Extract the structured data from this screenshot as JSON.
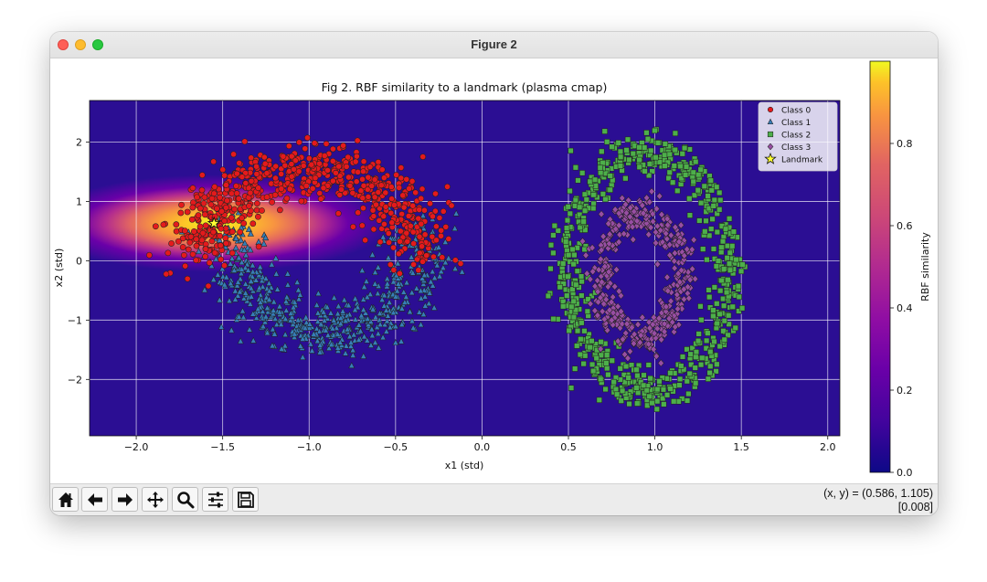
{
  "window": {
    "title": "Figure 2"
  },
  "toolbar": {
    "buttons": [
      "home",
      "back",
      "forward",
      "pan",
      "zoom",
      "configure-subplots",
      "save"
    ],
    "coords_line1": "(x, y) = (0.586, 1.105)",
    "coords_line2": "[0.008]"
  },
  "chart_data": {
    "type": "scatter",
    "title": "Fig 2. RBF similarity to a landmark (plasma cmap)",
    "xlabel": "x1 (std)",
    "ylabel": "x2 (std)",
    "xlim": [
      -2.27,
      2.07
    ],
    "ylim": [
      -2.95,
      2.7
    ],
    "x_ticks": [
      "−2.0",
      "−1.5",
      "−1.0",
      "−0.5",
      "0.0",
      "0.5",
      "1.0",
      "1.5",
      "2.0"
    ],
    "x_tick_values": [
      -2.0,
      -1.5,
      -1.0,
      -0.5,
      0.0,
      0.5,
      1.0,
      1.5,
      2.0
    ],
    "y_ticks": [
      "−2",
      "−1",
      "0",
      "1",
      "2"
    ],
    "y_tick_values": [
      -2,
      -1,
      0,
      1,
      2
    ],
    "grid": true,
    "legend_position": "top-right",
    "background": {
      "colormap": "plasma",
      "kind": "rbf",
      "center": [
        -1.55,
        0.63
      ],
      "gamma": 2.5
    },
    "colorbar": {
      "label": "RBF similarity",
      "range": [
        0.0,
        1.0
      ],
      "tick_labels": [
        "0.0",
        "0.2",
        "0.4",
        "0.6",
        "0.8"
      ],
      "tick_values": [
        0.0,
        0.2,
        0.4,
        0.6,
        0.8
      ]
    },
    "landmark": {
      "name": "Landmark",
      "x": -1.55,
      "y": 0.63,
      "color": "#ffff33"
    },
    "series": [
      {
        "name": "Class 0",
        "marker": "circle",
        "color": "#e41a1c",
        "shape": "upper-moon",
        "center": [
          -1.0,
          0.1
        ],
        "radius": 0.62,
        "noise": 0.12,
        "angle_range": [
          0,
          180
        ],
        "y_scale": 2.3,
        "points": 700
      },
      {
        "name": "Class 1",
        "marker": "triangle",
        "color": "#377eb8",
        "shape": "lower-moon",
        "center": [
          -0.9,
          0.55
        ],
        "radius": 0.55,
        "noise": 0.11,
        "angle_range": [
          180,
          360
        ],
        "y_scale": 3.2,
        "points": 600
      },
      {
        "name": "Class 2",
        "marker": "square",
        "color": "#4daf4a",
        "shape": "ring",
        "center": [
          0.96,
          -0.2
        ],
        "rx": 0.46,
        "ry": 2.0,
        "noise": 0.05,
        "points": 700
      },
      {
        "name": "Class 3",
        "marker": "diamond",
        "color": "#984ea3",
        "shape": "ring",
        "center": [
          0.92,
          -0.25
        ],
        "rx": 0.23,
        "ry": 1.05,
        "noise": 0.045,
        "points": 450
      }
    ]
  }
}
